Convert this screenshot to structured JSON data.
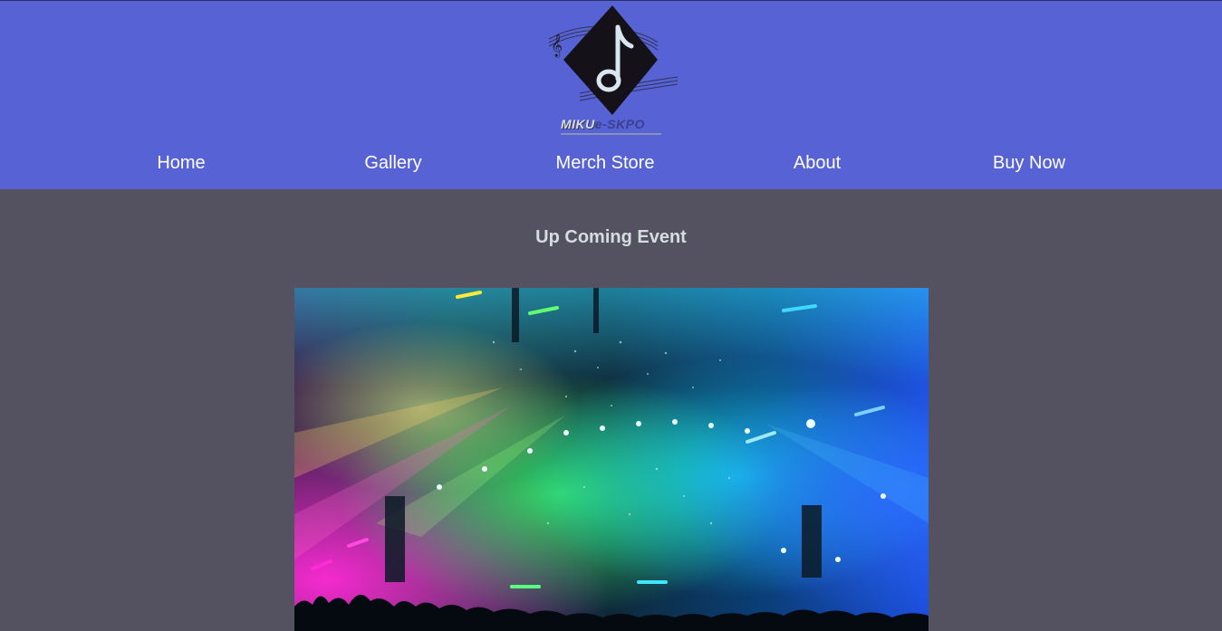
{
  "logo": {
    "icon": "music-note-icon",
    "brand_primary": "MIKU",
    "brand_secondary": "e-SKPO"
  },
  "nav": {
    "items": [
      {
        "label": "Home"
      },
      {
        "label": "Gallery"
      },
      {
        "label": "Merch Store"
      },
      {
        "label": "About"
      },
      {
        "label": "Buy Now"
      }
    ]
  },
  "main": {
    "section_title": "Up Coming Event"
  },
  "colors": {
    "header_bg": "#5762d5",
    "page_bg": "#545161",
    "nav_text": "#ffffff",
    "title_text": "#d6dde0"
  }
}
